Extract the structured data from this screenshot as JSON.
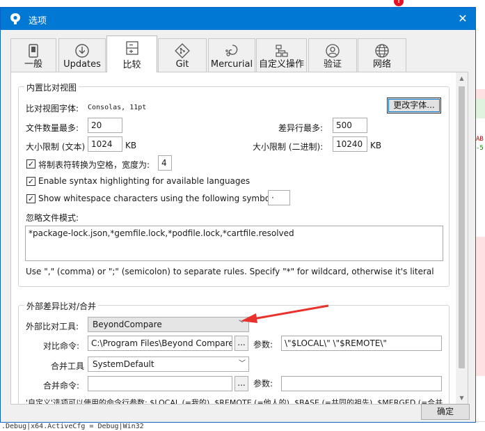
{
  "dialog": {
    "title": "选项",
    "close_symbol": "✕"
  },
  "tabs": [
    {
      "label": "一般",
      "icon": "phone-icon"
    },
    {
      "label": "Updates",
      "icon": "download-icon"
    },
    {
      "label": "比较",
      "icon": "compare-icon",
      "active": true
    },
    {
      "label": "Git",
      "icon": "git-icon"
    },
    {
      "label": "Mercurial",
      "icon": "mercurial-icon"
    },
    {
      "label": "自定义操作",
      "icon": "custom-actions-icon"
    },
    {
      "label": "验证",
      "icon": "user-icon"
    },
    {
      "label": "网络",
      "icon": "globe-icon"
    }
  ],
  "diff_view": {
    "group_title": "内置比对视图",
    "font_label": "比对视图字体:",
    "font_value": "Consolas, 11pt",
    "change_font_button": "更改字体...",
    "max_files_label": "文件数量最多:",
    "max_files_value": "20",
    "max_diff_lines_label": "差异行最多:",
    "max_diff_lines_value": "500",
    "size_text_label": "大小限制 (文本)",
    "size_text_value": "1024",
    "size_text_unit": "KB",
    "size_binary_label": "大小限制 (二进制):",
    "size_binary_value": "10240",
    "size_binary_unit": "KB",
    "tabs_to_spaces_label": "将制表符转换为空格，宽度为:",
    "tabs_to_spaces_checked": true,
    "tab_width_value": "4",
    "syntax_highlighting_label": "Enable syntax highlighting for available languages",
    "syntax_highlighting_checked": true,
    "show_whitespace_label": "Show whitespace characters using the following symbol:",
    "show_whitespace_checked": true,
    "whitespace_symbol_value": "·",
    "ignore_patterns_label": "忽略文件模式:",
    "ignore_patterns_value": "*package-lock.json,*gemfile.lock,*podfile.lock,*cartfile.resolved",
    "ignore_hint": "Use \",\" (comma) or \";\" (semicolon) to separate rules. Specify \"*\" for wildcard, otherwise it's literal"
  },
  "external": {
    "group_title": "外部差异比对/合并",
    "diff_tool_label": "外部比对工具:",
    "diff_tool_value": "BeyondCompare",
    "diff_command_label": "对比命令:",
    "diff_command_value": "C:\\Program Files\\Beyond Compare",
    "browse_label": "...",
    "args_label": "参数:",
    "diff_args_value": "\\\"$LOCAL\\\" \\\"$REMOTE\\\"",
    "merge_tool_label": "合并工具",
    "merge_tool_value": "SystemDefault",
    "merge_command_label": "合并命令:",
    "merge_command_value": "",
    "merge_args_value": "",
    "footnote": "'自定义'选项可以使用的命令行参数: $LOCAL (=我的), $REMOTE (=他人的), $BASE (=共同的祖先), $MERGED (=合并"
  },
  "ok_button": "确定",
  "background": {
    "status_text": ".Debug|x64.ActiveCfg = Debug|Win32",
    "badge": "!",
    "side_text_1": "AB",
    "side_text_2": "-5"
  },
  "colors": {
    "titlebar": "#0078d4",
    "arrow": "#e8332c",
    "badge": "#e81123"
  }
}
